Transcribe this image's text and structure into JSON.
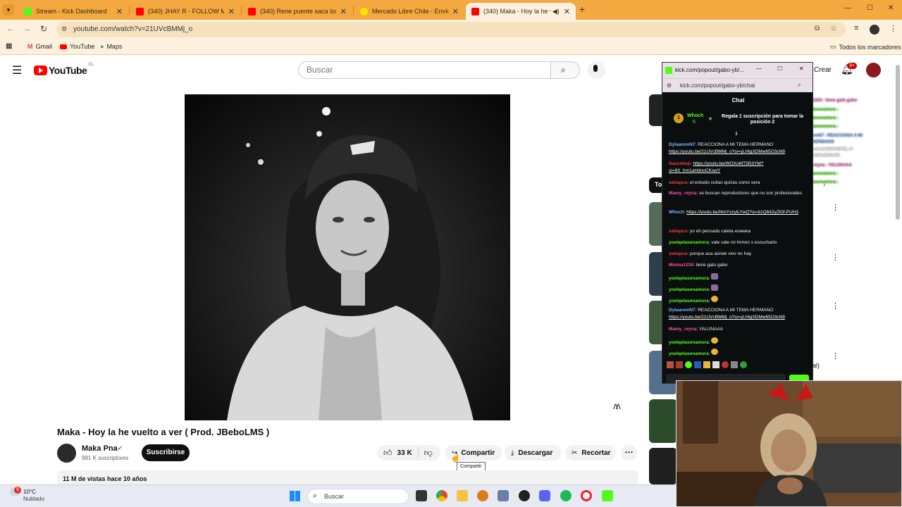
{
  "browser": {
    "tabs": [
      {
        "label": "Stream - Kick Dashboard",
        "favicon_color": "#53fc18"
      },
      {
        "label": "(340) JHAY R - FOLLOW ME - Y",
        "favicon_color": "#ff0000"
      },
      {
        "label": "(340) Rene puente saca los pas",
        "favicon_color": "#ff0000"
      },
      {
        "label": "Mercado Libre Chile - Envíos G",
        "favicon_color": "#ffe600"
      },
      {
        "label": "(340) Maka - Hoy la he vuel",
        "favicon_color": "#ff0000"
      }
    ],
    "url": "youtube.com/watch?v=21UVcBMMj_o",
    "bookmarks": [
      "Gmail",
      "YouTube",
      "Maps"
    ],
    "all_bookmarks": "Todos los marcadores"
  },
  "youtube": {
    "logo": "YouTube",
    "region": "CL",
    "search_placeholder": "Buscar",
    "create_label": "Crear",
    "notification_count": "9+",
    "video_title": "Maka - Hoy la he vuelto a ver ( Prod. JBeboLMS )",
    "channel_name": "Maka Pna",
    "subscribers": "991 K suscriptores",
    "subscribe_label": "Suscribirse",
    "likes": "33 K",
    "share_label": "Compartir",
    "share_tooltip": "Compartir",
    "download_label": "Descargar",
    "clip_label": "Recortar",
    "views_line": "11 M de vistas  hace 10 años",
    "chip_label": "To",
    "side_text": "al)"
  },
  "kick": {
    "window_title": "kick.com/popout/gabo-yb/...",
    "url": "kick.com/popout/gabo-yb/chat",
    "chat_header": "Chat",
    "top_gifter": "Whoch",
    "top_gifter_count": "5",
    "gift_text": "Regala 1 suscripción para tomar la posición 2",
    "messages": [
      {
        "user": "DylaannnN7",
        "color": "blue",
        "text": ": REACCIONA A MI TEMA HERMANO ",
        "link": "https://youtu.be/21UVcBMMj_o?si=yLHigXDMw65O3cN9"
      },
      {
        "user": "Saucebsp",
        "color": "red",
        "text": ": ",
        "link": "https://youtu.be/WOXoMT5R3YM?si=6X_hm1aHdnnCKswY"
      },
      {
        "user": "sebapus",
        "color": "red",
        "text": ": el estudio culiao quizas como sera",
        "link": ""
      },
      {
        "user": "Mamy_reyna",
        "color": "pink",
        "text": ": se buscan reproductores que no son profesionales",
        "link": ""
      },
      {
        "user": "Whoch",
        "color": "blue",
        "text": ": ",
        "link": "https://youtu.be/NmYxzyiLYwQ?si=b1Q642yZKlf-PUH3"
      },
      {
        "user": "sebapus",
        "color": "red",
        "text": ": yo eh pensado caleta esawea",
        "link": ""
      },
      {
        "user": "yoelqelasenamora",
        "color": "green",
        "text": ": vale vale mi hrmno x escucharlo",
        "link": ""
      },
      {
        "user": "sebapus",
        "color": "red",
        "text": ": porque aca aonde vivo no hay",
        "link": ""
      },
      {
        "user": "Minina1234",
        "color": "pink",
        "text": ": tiene gato gabo",
        "link": ""
      },
      {
        "user": "yoelqelasenamora",
        "color": "green",
        "text": ":",
        "link": ""
      },
      {
        "user": "yoelqelasenamora",
        "color": "green",
        "text": ":",
        "link": ""
      },
      {
        "user": "yoelqelasenamora",
        "color": "green",
        "text": ":",
        "link": ""
      },
      {
        "user": "DylaannnN7",
        "color": "blue",
        "text": ": REACCIONA A MI TEMA HERMANO ",
        "link": "https://youtu.be/21UVcBMMj_o?si=yLHigXDMw65O3cN9"
      },
      {
        "user": "Mamy_reyna",
        "color": "pink",
        "text": ": YALUNAAA",
        "link": ""
      },
      {
        "user": "yoelqelasenamora",
        "color": "green",
        "text": ":",
        "link": ""
      },
      {
        "user": "yoelqelasenamora",
        "color": "green",
        "text": ":",
        "link": ""
      }
    ]
  },
  "overlay_chat": [
    "Minina1234 : tiene gato gabo",
    "yoelqelasenamora :",
    "yoelqelasenamora :",
    "yoelqelasenamora :",
    "DylaannnN7 : REACCIONA A MI TEMA HERMANO",
    "https://youtu.be/21UVcBMMj_o?si=yLHigXDMw65O3cN9",
    "Mamy_reyna : YALUNAAA",
    "yoelqelasenamora :",
    "yoelqelasenamora :"
  ],
  "taskbar": {
    "weather_temp": "10°C",
    "weather_desc": "Nublado",
    "weather_badge": "5",
    "search_label": "Buscar"
  }
}
